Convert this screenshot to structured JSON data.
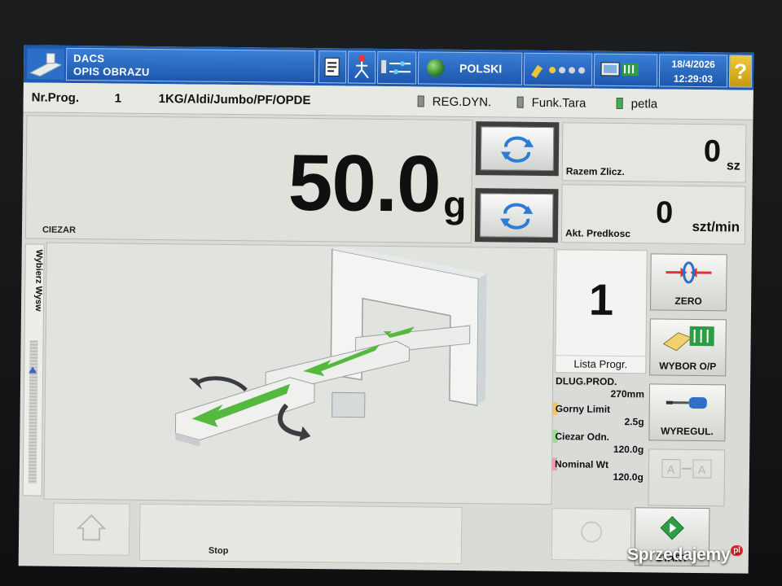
{
  "header": {
    "title_line1": "DACS",
    "title_line2": "OPIS OBRAZU",
    "language": "POLSKI",
    "date": "18/4/2026",
    "time": "12:29:03",
    "help_label": "?"
  },
  "program_line": {
    "nr_label": "Nr.Prog.",
    "nr_value": "1",
    "program_name": "1KG/Aldi/Jumbo/PF/OPDE",
    "indicators": [
      {
        "label": "REG.DYN.",
        "color": "#8a8f8b"
      },
      {
        "label": "Funk.Tara",
        "color": "#8a8f8b"
      },
      {
        "label": "petla",
        "color": "#3bb34a"
      }
    ]
  },
  "weight": {
    "value": "50.0",
    "unit": "g",
    "label": "CIEZAR"
  },
  "counters": {
    "total": {
      "value": "0",
      "unit": "sz",
      "label": "Razem Zlicz."
    },
    "speed": {
      "value": "0",
      "unit": "szt/min",
      "label": "Akt. Predkosc"
    }
  },
  "side_tab": {
    "label": "Wybierz Wysw"
  },
  "program_list": {
    "number": "1",
    "label": "Lista Progr."
  },
  "parameters": {
    "length_label": "DLUG.PROD.",
    "length_value": "270mm",
    "upper_label": "Gorny Limit",
    "upper_value": "2.5g",
    "ref_label": "Ciezar Odn.",
    "ref_value": "120.0g",
    "nominal_label": "Nominal Wt",
    "nominal_value": "120.0g",
    "colors": {
      "upper": "#f6c26a",
      "ref": "#9fdc9a",
      "nominal": "#f39ab8"
    }
  },
  "buttons": {
    "zero": "ZERO",
    "select_op": "WYBOR O/P",
    "adjust": "WYREGUL.",
    "start": "START",
    "stop_status": "Stop"
  },
  "watermark": {
    "brand": "Sprzedajemy",
    "suffix": "pl"
  },
  "colors": {
    "header_blue": "#1e5bb0",
    "accent_green": "#3bb34a",
    "help_yellow": "#e6b826"
  }
}
